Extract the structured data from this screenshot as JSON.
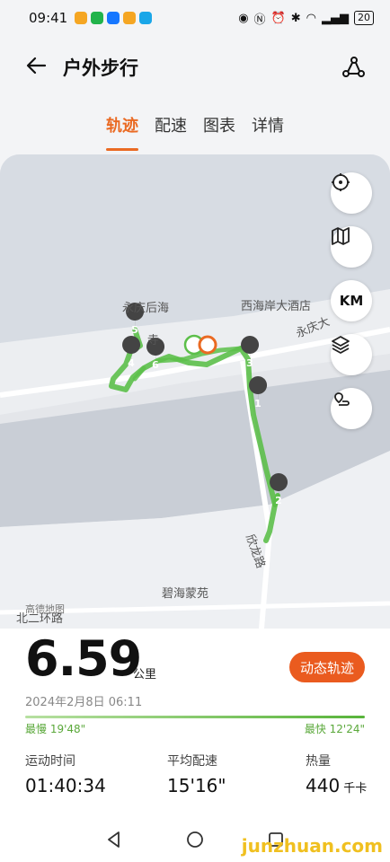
{
  "status_bar": {
    "time": "09:41",
    "battery": "20"
  },
  "header": {
    "title": "户外步行"
  },
  "tabs": [
    "轨迹",
    "配速",
    "图表",
    "详情"
  ],
  "map": {
    "labels": {
      "yongqing_houhai": "永庆后海",
      "xihaian_hotel": "西海岸大酒店",
      "yongqing_road": "永庆大",
      "temple": "寺",
      "xinlong_road": "欣龙路",
      "bihai_garden": "碧海蒙苑",
      "amap": "高德地图",
      "north_ring_road": "北二环路"
    },
    "km_label": "KM",
    "markers": [
      "1",
      "2",
      "3",
      "4",
      "5",
      "6"
    ]
  },
  "summary": {
    "distance": "6.59",
    "distance_unit": "公里",
    "dynamic_track_button": "动态轨迹",
    "date": "2024年2月8日 06:11",
    "slowest": "最慢 19'48\"",
    "fastest": "最快 12'24\""
  },
  "stats": [
    {
      "label": "运动时间",
      "value": "01:40:34",
      "unit": ""
    },
    {
      "label": "平均配速",
      "value": "15'16\"",
      "unit": ""
    },
    {
      "label": "热量",
      "value": "440",
      "unit": "千卡"
    }
  ],
  "watermark": "junzhuan.com",
  "colors": {
    "accent": "#ea6a23",
    "track": "#5cbf4a",
    "button": "#ea5b1f"
  }
}
